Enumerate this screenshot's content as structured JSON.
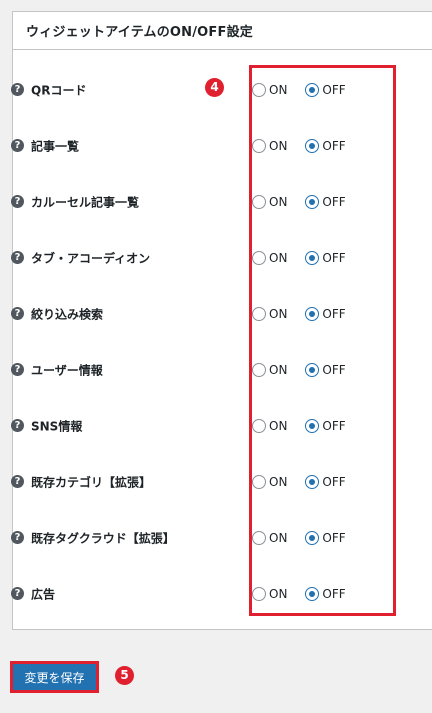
{
  "panel": {
    "title": "ウィジェットアイテムのON/OFF設定"
  },
  "help_icon_glyph": "?",
  "radio": {
    "on_label": "ON",
    "off_label": "OFF"
  },
  "rows": [
    {
      "label": "QRコード",
      "selected": "OFF"
    },
    {
      "label": "記事一覧",
      "selected": "OFF"
    },
    {
      "label": "カルーセル記事一覧",
      "selected": "OFF"
    },
    {
      "label": "タブ・アコーディオン",
      "selected": "OFF"
    },
    {
      "label": "絞り込み検索",
      "selected": "OFF"
    },
    {
      "label": "ユーザー情報",
      "selected": "OFF"
    },
    {
      "label": "SNS情報",
      "selected": "OFF"
    },
    {
      "label": "既存カテゴリ【拡張】",
      "selected": "OFF"
    },
    {
      "label": "既存タグクラウド【拡張】",
      "selected": "OFF"
    },
    {
      "label": "広告",
      "selected": "OFF"
    }
  ],
  "annotations": {
    "badge_4": "4",
    "badge_5": "5",
    "highlight_color": "#e0202e"
  },
  "save_button": {
    "label": "変更を保存",
    "color": "#2271b1"
  }
}
